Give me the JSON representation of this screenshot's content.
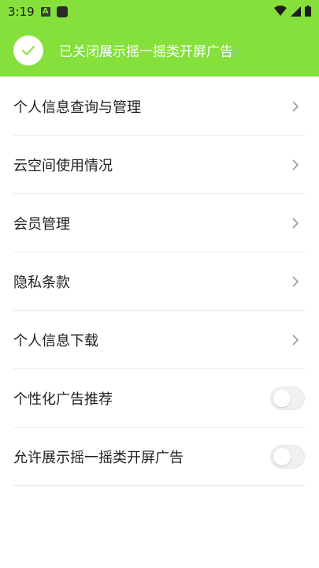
{
  "status_bar": {
    "time": "3:19",
    "notification_glyph": "A"
  },
  "banner": {
    "message": "已关闭展示摇一摇类开屏广告",
    "background": "#85e03b",
    "icon": "check-icon"
  },
  "menu": {
    "items": [
      {
        "label": "个人信息查询与管理",
        "control": "chevron"
      },
      {
        "label": "云空间使用情况",
        "control": "chevron"
      },
      {
        "label": "会员管理",
        "control": "chevron"
      },
      {
        "label": "隐私条款",
        "control": "chevron"
      },
      {
        "label": "个人信息下载",
        "control": "chevron"
      },
      {
        "label": "个性化广告推荐",
        "control": "toggle",
        "enabled": false
      },
      {
        "label": "允许展示摇一摇类开屏广告",
        "control": "toggle",
        "enabled": false
      }
    ]
  }
}
